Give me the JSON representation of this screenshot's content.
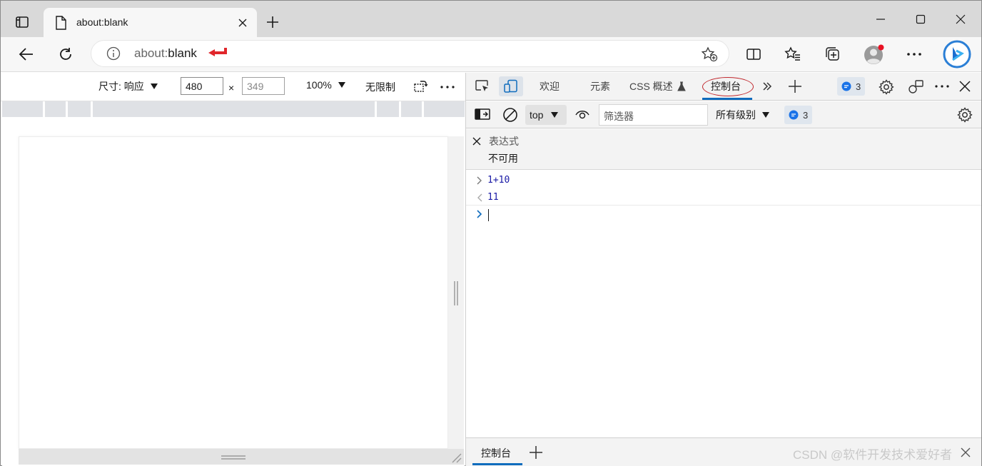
{
  "window": {
    "tab_title": "about:blank"
  },
  "address_bar": {
    "url_scheme": "about:",
    "url_rest": "blank",
    "annotation_color": "#e0262b"
  },
  "device_toolbar": {
    "dimensions_label": "尺寸: 响应",
    "width_value": "480",
    "times_sign": "×",
    "height_value": "349",
    "zoom": "100%",
    "throttle": "无限制"
  },
  "devtools": {
    "tabs": [
      "欢迎",
      "元素",
      "CSS 概述",
      "控制台"
    ],
    "active_tab": "控制台",
    "issues_count": "3",
    "context": "top",
    "filter_placeholder": "筛选器",
    "levels": "所有级别",
    "messages_count": "3",
    "live_expression": {
      "label": "表达式",
      "value": "不可用"
    },
    "console_lines": [
      {
        "kind": "input",
        "text": "1+10"
      },
      {
        "kind": "output",
        "text": "11"
      }
    ],
    "drawer_tab": "控制台",
    "accent_color": "#0f6cbd"
  },
  "watermark": "CSDN @软件开发技术爱好者"
}
